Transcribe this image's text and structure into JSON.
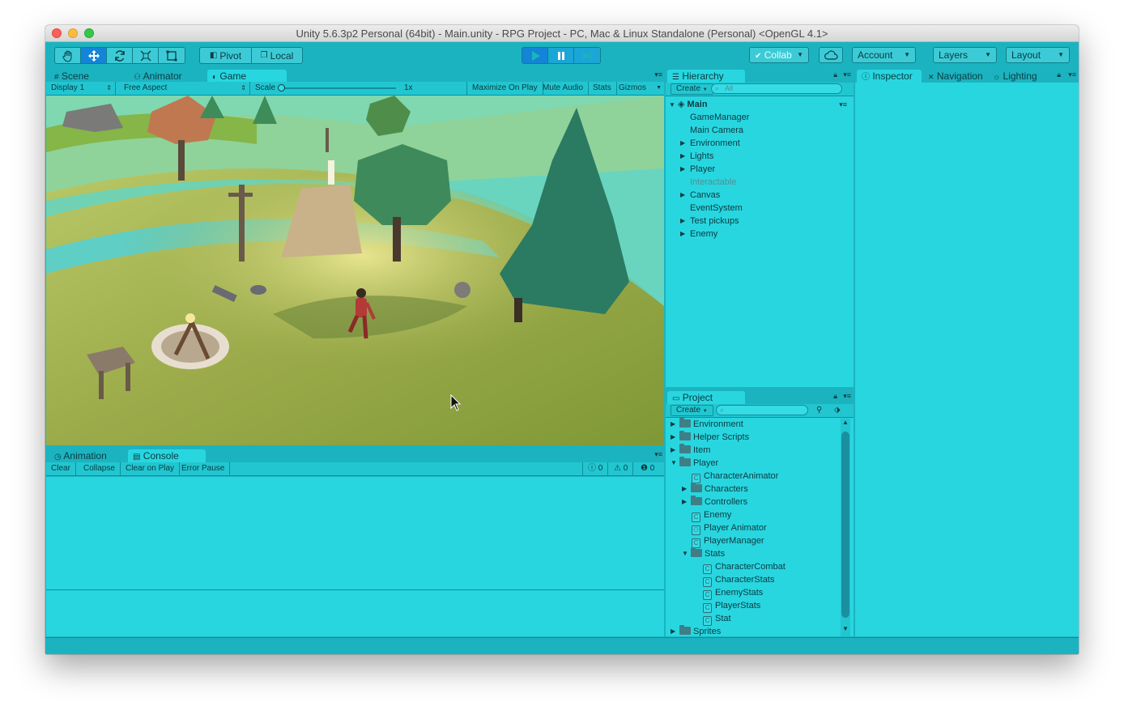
{
  "window": {
    "title": "Unity 5.6.3p2 Personal (64bit) - Main.unity - RPG Project - PC, Mac & Linux Standalone (Personal) <OpenGL 4.1>"
  },
  "toolbar": {
    "pivot_label": "Pivot",
    "local_label": "Local",
    "collab_label": "Collab",
    "account_label": "Account",
    "layers_label": "Layers",
    "layout_label": "Layout"
  },
  "scene_tabs": [
    {
      "label": "Scene",
      "icon": "grid-icon"
    },
    {
      "label": "Animator",
      "icon": "animator-icon"
    },
    {
      "label": "Game",
      "icon": "game-icon"
    }
  ],
  "game_bar": {
    "display": "Display 1",
    "aspect": "Free Aspect",
    "scale_label": "Scale",
    "scale_value": "1x",
    "maximize": "Maximize On Play",
    "mute": "Mute Audio",
    "stats": "Stats",
    "gizmos": "Gizmos"
  },
  "bottom_tabs": [
    {
      "label": "Animation",
      "icon": "clock-icon"
    },
    {
      "label": "Console",
      "icon": "console-icon"
    }
  ],
  "console_bar": {
    "clear": "Clear",
    "collapse": "Collapse",
    "clear_on_play": "Clear on Play",
    "error_pause": "Error Pause",
    "info_count": "0",
    "warning_count": "0",
    "error_count": "0"
  },
  "hierarchy": {
    "tab_label": "Hierarchy",
    "create_label": "Create",
    "search_placeholder": "All",
    "scene_name": "Main",
    "items": [
      {
        "label": "GameManager",
        "expandable": false,
        "dim": false
      },
      {
        "label": "Main Camera",
        "expandable": false,
        "dim": false
      },
      {
        "label": "Environment",
        "expandable": true,
        "dim": false
      },
      {
        "label": "Lights",
        "expandable": true,
        "dim": false
      },
      {
        "label": "Player",
        "expandable": true,
        "dim": false
      },
      {
        "label": "Interactable",
        "expandable": false,
        "dim": true
      },
      {
        "label": "Canvas",
        "expandable": true,
        "dim": false
      },
      {
        "label": "EventSystem",
        "expandable": false,
        "dim": false
      },
      {
        "label": "Test pickups",
        "expandable": true,
        "dim": false
      },
      {
        "label": "Enemy",
        "expandable": true,
        "dim": false
      }
    ]
  },
  "project": {
    "tab_label": "Project",
    "create_label": "Create",
    "items": [
      {
        "label": "Environment",
        "type": "folder",
        "depth": 0,
        "state": "collapsed"
      },
      {
        "label": "Helper Scripts",
        "type": "folder",
        "depth": 0,
        "state": "collapsed"
      },
      {
        "label": "Item",
        "type": "folder",
        "depth": 0,
        "state": "collapsed"
      },
      {
        "label": "Player",
        "type": "folder",
        "depth": 0,
        "state": "expanded"
      },
      {
        "label": "CharacterAnimator",
        "type": "script",
        "depth": 1,
        "state": "none"
      },
      {
        "label": "Characters",
        "type": "folder",
        "depth": 1,
        "state": "collapsed"
      },
      {
        "label": "Controllers",
        "type": "folder",
        "depth": 1,
        "state": "collapsed"
      },
      {
        "label": "Enemy",
        "type": "script",
        "depth": 1,
        "state": "none"
      },
      {
        "label": "Player Animator",
        "type": "animator",
        "depth": 1,
        "state": "none"
      },
      {
        "label": "PlayerManager",
        "type": "script",
        "depth": 1,
        "state": "none"
      },
      {
        "label": "Stats",
        "type": "folder",
        "depth": 1,
        "state": "expanded"
      },
      {
        "label": "CharacterCombat",
        "type": "script",
        "depth": 2,
        "state": "none"
      },
      {
        "label": "CharacterStats",
        "type": "script",
        "depth": 2,
        "state": "none"
      },
      {
        "label": "EnemyStats",
        "type": "script",
        "depth": 2,
        "state": "none"
      },
      {
        "label": "PlayerStats",
        "type": "script",
        "depth": 2,
        "state": "none"
      },
      {
        "label": "Stat",
        "type": "script",
        "depth": 2,
        "state": "none"
      },
      {
        "label": "Sprites",
        "type": "folder",
        "depth": 0,
        "state": "collapsed"
      }
    ]
  },
  "inspector_tabs": [
    {
      "label": "Inspector",
      "icon": "info-icon"
    },
    {
      "label": "Navigation",
      "icon": "nav-icon"
    },
    {
      "label": "Lighting",
      "icon": "lighting-icon"
    }
  ],
  "colors": {
    "editor_bg": "#1cb3c0",
    "panel_bg": "#28d6e0",
    "play_active": "#1484d6"
  }
}
